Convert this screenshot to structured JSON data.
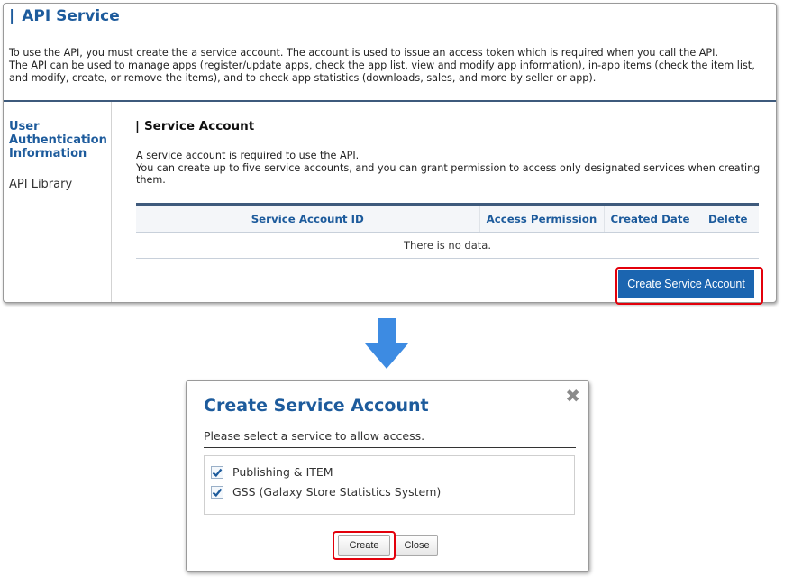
{
  "page": {
    "title": "API Service",
    "intro": [
      "To use the API, you must create the a service account. The account is used to issue an access token which is required when you call the API.",
      "The API can be used to manage apps (register/update apps, check the app list, view and modify app information), in-app items (check the item list, and modify, create, or remove the items), and to check app statistics (downloads, sales, and more by seller or app)."
    ]
  },
  "sidebar": {
    "active_item": "User Authentication Information",
    "items": [
      "API Library"
    ]
  },
  "section": {
    "title": "Service Account",
    "description": [
      "A service account is required to use the API.",
      "You can create up to five service accounts, and you can grant permission to access only designated services when creating them."
    ],
    "table": {
      "columns": [
        "Service Account ID",
        "Access Permission",
        "Created Date",
        "Delete"
      ],
      "empty_text": "There is no data."
    },
    "create_button": "Create Service Account"
  },
  "dialog": {
    "title": "Create Service Account",
    "description": "Please select a service to allow access.",
    "services": [
      {
        "label": "Publishing & ITEM",
        "checked": true
      },
      {
        "label": "GSS (Galaxy Store Statistics System)",
        "checked": true
      }
    ],
    "create_button": "Create",
    "close_button": "Close"
  },
  "colors": {
    "brand_blue": "#1d5b9c",
    "button_blue": "#1b65b0",
    "highlight_red": "#e3000b",
    "arrow_blue": "#3d8be2"
  }
}
